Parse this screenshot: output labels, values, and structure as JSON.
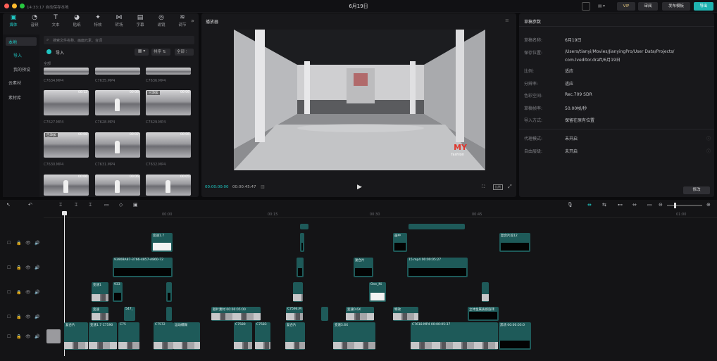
{
  "titlebar": {
    "left_status": "14:33:17 自动保存本地",
    "title": "6月19日",
    "vip": "VIP",
    "review": "审阅",
    "publish": "发布模板",
    "export": "导出",
    "user_icon": "user-icon"
  },
  "media_tabs": [
    {
      "label": "媒体",
      "icon": "media-icon"
    },
    {
      "label": "音频",
      "icon": "audio-icon"
    },
    {
      "label": "文本",
      "icon": "text-icon"
    },
    {
      "label": "贴纸",
      "icon": "sticker-icon"
    },
    {
      "label": "特效",
      "icon": "effects-icon"
    },
    {
      "label": "转场",
      "icon": "transition-icon"
    },
    {
      "label": "字幕",
      "icon": "caption-icon"
    },
    {
      "label": "滤镜",
      "icon": "filter-icon"
    },
    {
      "label": "调节",
      "icon": "adjust-icon"
    }
  ],
  "sidebar": {
    "items": [
      "本地",
      "导入",
      "我的预设",
      "云素材",
      "素材库"
    ]
  },
  "media": {
    "search_placeholder": "搜索文件名称、画面元素、台词",
    "import_label": "导入",
    "sort_label": "排序",
    "all_label": "全部",
    "section_label": "全部",
    "row1_names": [
      "C7634.MP4",
      "C7635.MP4",
      "C7636.MP4"
    ],
    "row2": [
      {
        "name": "C7627.MP4",
        "dur": "00:12",
        "tag": ""
      },
      {
        "name": "C7628.MP4",
        "dur": "00:06",
        "tag": ""
      },
      {
        "name": "C7629.MP4",
        "dur": "00:06",
        "tag": "已添加"
      }
    ],
    "row3": [
      {
        "name": "C7630.MP4",
        "dur": "00:08",
        "tag": "已添加"
      },
      {
        "name": "C7631.MP4",
        "dur": "00:07",
        "tag": ""
      },
      {
        "name": "C7632.MP4",
        "dur": "00:06",
        "tag": ""
      }
    ],
    "row4": [
      {
        "dur": "00:06"
      },
      {
        "dur": "00:06"
      },
      {
        "dur": "00:05"
      }
    ]
  },
  "player": {
    "title": "播放器",
    "current_time": "00:00:00:00",
    "total_time": "00:00:45:47",
    "logo_text": "MY",
    "logo_sub": "fashion"
  },
  "draft": {
    "title": "草稿参数",
    "rows": [
      {
        "label": "草稿名称:",
        "value": "6月19日"
      },
      {
        "label": "保存位置:",
        "value": "/Users/tianyi/Movies/JianyingPro/User Data/Projects/"
      },
      {
        "label": "",
        "value": "com.lveditor.draft/6月19日"
      },
      {
        "label": "比例:",
        "value": "适应"
      },
      {
        "label": "分辨率:",
        "value": "适应"
      },
      {
        "label": "色彩空间:",
        "value": "Rec.709 SDR"
      },
      {
        "label": "草稿帧率:",
        "value": "50.00帧/秒"
      },
      {
        "label": "导入方式:",
        "value": "保留在原有位置"
      },
      {
        "label": "代理模式:",
        "value": "未开启"
      },
      {
        "label": "自由层级:",
        "value": "未开启"
      }
    ],
    "modify_label": "修改"
  },
  "timeline": {
    "ticks": [
      "00:00",
      "00:15",
      "00:30",
      "00:45",
      "01:00"
    ],
    "track1": [
      {
        "label": "变速1.7"
      },
      {
        "label": ""
      },
      {
        "label": "画中"
      },
      {
        "label": "复合片段12"
      }
    ],
    "track2": [
      {
        "label": "9390BA87-3766-4857-A860-72"
      },
      {
        "label": ""
      },
      {
        "label": "复合片"
      },
      {
        "label": "15.mp4 00:00:05:27"
      }
    ],
    "track3": [
      {
        "label": "变速1"
      },
      {
        "label": "933"
      },
      {
        "label": ""
      },
      {
        "label": "One_Ni"
      }
    ],
    "track4": [
      {
        "label": "变速"
      },
      {
        "label": "547_"
      },
      {
        "label": "颜片素材 00:00:05:00"
      },
      {
        "label": "C7594.M"
      },
      {
        "label": "变速0.6X"
      },
      {
        "label": "特效"
      },
      {
        "label": "立体金属质感旋转"
      }
    ],
    "main": [
      {
        "label": "复合片"
      },
      {
        "label": "变速1.7 C7590"
      },
      {
        "label": "C75"
      },
      {
        "label": "C7572"
      },
      {
        "label": "运动模糊"
      },
      {
        "label": "C7580"
      },
      {
        "label": "C7583"
      },
      {
        "label": "复合片"
      },
      {
        "label": "变速5.6X"
      },
      {
        "label": "C7618.MP4 00:00:05:37"
      },
      {
        "label": "黑场 00:00:03:0"
      }
    ]
  }
}
